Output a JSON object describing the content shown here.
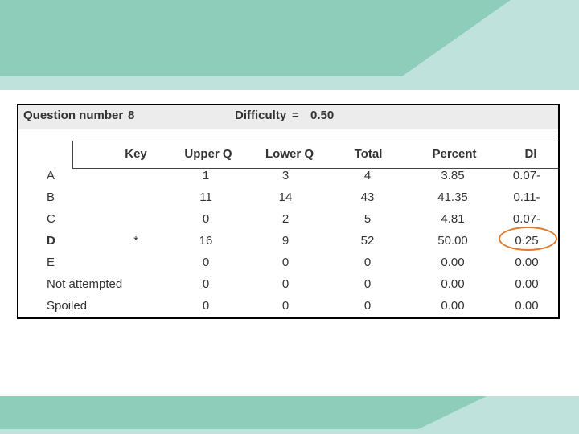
{
  "header": {
    "question_label": "Question number",
    "question_number": "8",
    "difficulty_label": "Difficulty",
    "difficulty_equals": "=",
    "difficulty_value": "0.50"
  },
  "columns": {
    "key": "Key",
    "upper_q": "Upper Q",
    "lower_q": "Lower Q",
    "total": "Total",
    "percent": "Percent",
    "di": "DI"
  },
  "rows": [
    {
      "option": "A",
      "key": "",
      "upper_q": "1",
      "lower_q": "3",
      "total": "4",
      "percent": "3.85",
      "di": "0.07-"
    },
    {
      "option": "B",
      "key": "",
      "upper_q": "11",
      "lower_q": "14",
      "total": "43",
      "percent": "41.35",
      "di": "0.11-"
    },
    {
      "option": "C",
      "key": "",
      "upper_q": "0",
      "lower_q": "2",
      "total": "5",
      "percent": "4.81",
      "di": "0.07-"
    },
    {
      "option": "D",
      "key": "*",
      "upper_q": "16",
      "lower_q": "9",
      "total": "52",
      "percent": "50.00",
      "di": "0.25"
    },
    {
      "option": "E",
      "key": "",
      "upper_q": "0",
      "lower_q": "0",
      "total": "0",
      "percent": "0.00",
      "di": "0.00"
    },
    {
      "option": "Not attempted",
      "key": "",
      "upper_q": "0",
      "lower_q": "0",
      "total": "0",
      "percent": "0.00",
      "di": "0.00"
    },
    {
      "option": "Spoiled",
      "key": "",
      "upper_q": "0",
      "lower_q": "0",
      "total": "0",
      "percent": "0.00",
      "di": "0.00"
    }
  ],
  "highlight": {
    "row": "D",
    "column": "di",
    "color": "#e07a2e"
  },
  "colors": {
    "band_light": "#bfe3dc",
    "band_dark": "#8ecdb9"
  }
}
